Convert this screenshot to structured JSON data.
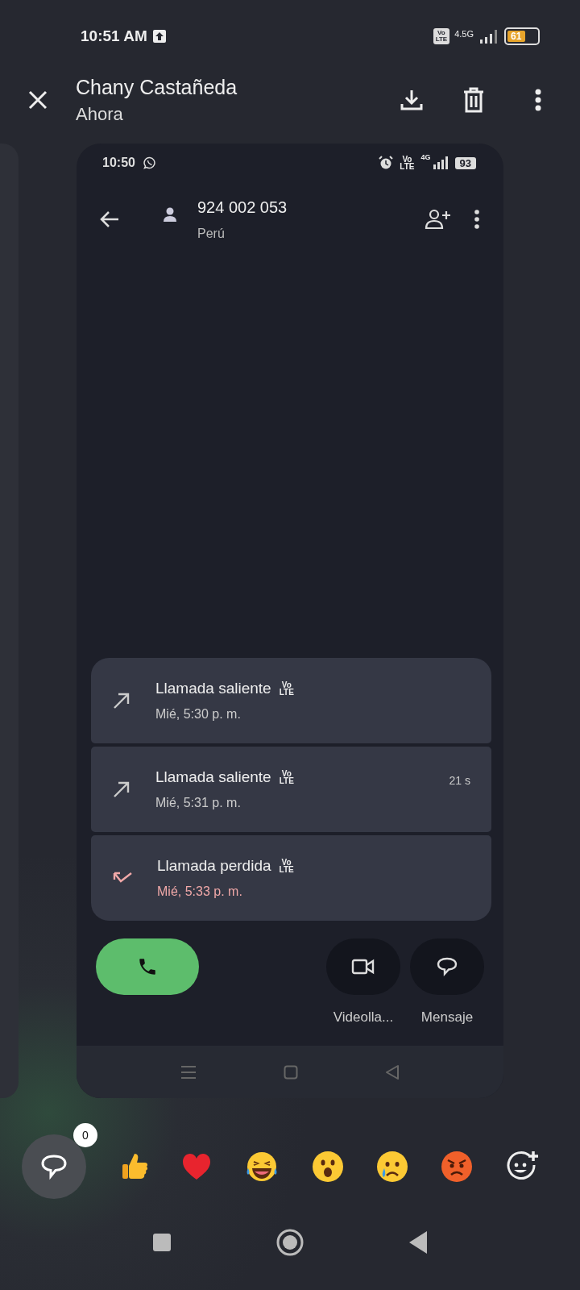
{
  "status_bar": {
    "time": "10:51 AM",
    "network": "4.5G",
    "battery": "61",
    "volte": [
      "Vo",
      "LTE"
    ]
  },
  "header": {
    "title": "Chany Castañeda",
    "subtitle": "Ahora"
  },
  "screenshot": {
    "status_bar": {
      "time": "10:50",
      "network": "4G",
      "battery": "93",
      "volte": [
        "Vo",
        "LTE"
      ]
    },
    "contact": {
      "number": "924 002 053",
      "country": "Perú"
    },
    "calls": [
      {
        "kind": "outgoing",
        "label": "Llamada saliente",
        "badge": [
          "Vo",
          "LTE"
        ],
        "time": "Mié, 5:30 p. m."
      },
      {
        "kind": "outgoing",
        "label": "Llamada saliente",
        "badge": [
          "Vo",
          "LTE"
        ],
        "time": "Mié, 5:31 p. m.",
        "duration": "21 s"
      },
      {
        "kind": "missed",
        "label": "Llamada perdida",
        "badge": [
          "Vo",
          "LTE"
        ],
        "time": "Mié, 5:33 p. m."
      }
    ],
    "actions": [
      {
        "kind": "video",
        "label": "Videolla..."
      },
      {
        "kind": "message",
        "label": "Mensaje"
      }
    ]
  },
  "comments": {
    "count": "0"
  },
  "reactions": [
    {
      "kind": "thumbs_up"
    },
    {
      "kind": "heart"
    },
    {
      "kind": "laughing"
    },
    {
      "kind": "surprised"
    },
    {
      "kind": "crying"
    },
    {
      "kind": "angry"
    },
    {
      "kind": "add"
    }
  ]
}
